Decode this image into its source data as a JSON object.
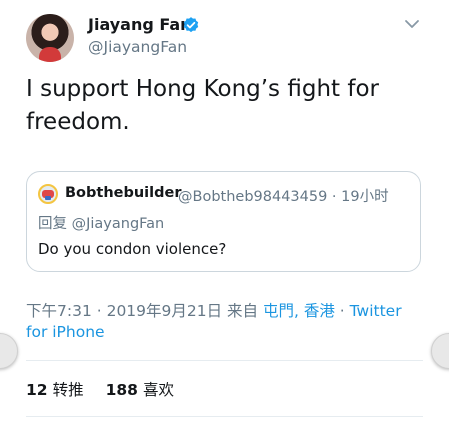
{
  "tweet": {
    "author_name": "Jiayang Fan",
    "author_handle": "@JiayangFan",
    "verified": true,
    "text": "I support Hong Kong’s fight for freedom.",
    "quote": {
      "name": "Bobthebuilder",
      "handle_time": "@Bobtheb98443459 · 19小时",
      "reply_to": "回复 @JiayangFan",
      "text": "Do you condon violence?"
    },
    "meta": {
      "time_date": "下午7:31 · 2019年9月21日 来自 ",
      "location": "屯門, 香港",
      "separator": " · ",
      "source": "Twitter for iPhone"
    },
    "stats": {
      "retweets": "12",
      "retweets_label": "转推",
      "likes": "188",
      "likes_label": "喜欢"
    }
  },
  "colors": {
    "link": "#1b95e0",
    "secondary_text": "#657786",
    "verified": "#1da1f2"
  },
  "icons": {
    "verified": "verified-badge-icon",
    "menu": "chevron-down-icon"
  }
}
